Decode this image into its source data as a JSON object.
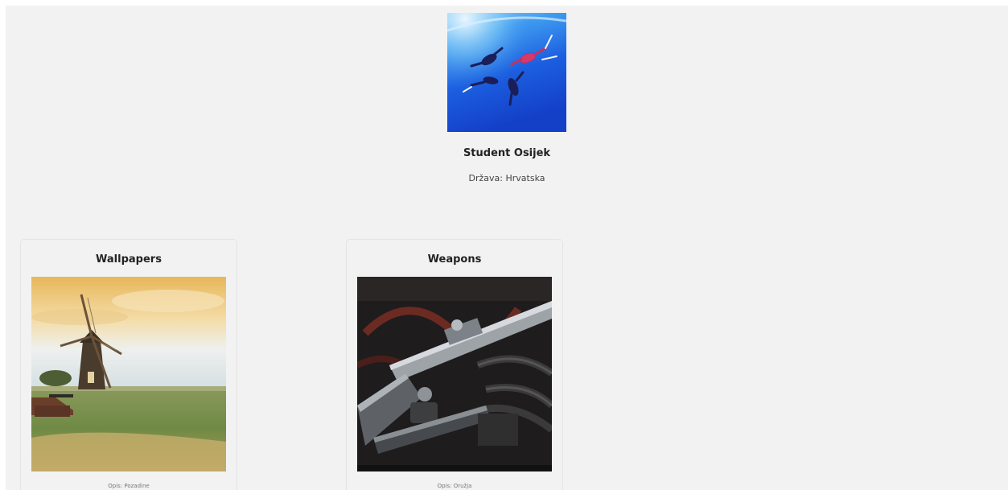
{
  "profile": {
    "name": "Student Osijek",
    "country": "Država: Hrvatska",
    "avatar_icon": "skydivers-photo"
  },
  "albums": [
    {
      "title": "Wallpapers",
      "description": "Opis: Pozadine",
      "image_icon": "windmill-photo"
    },
    {
      "title": "Weapons",
      "description": "Opis: Oružja",
      "image_icon": "rifle-photo"
    }
  ],
  "colors": {
    "background": "#f2f2f2",
    "card_border": "#e4e4e4",
    "sky_blue": "#1e5ad8"
  }
}
